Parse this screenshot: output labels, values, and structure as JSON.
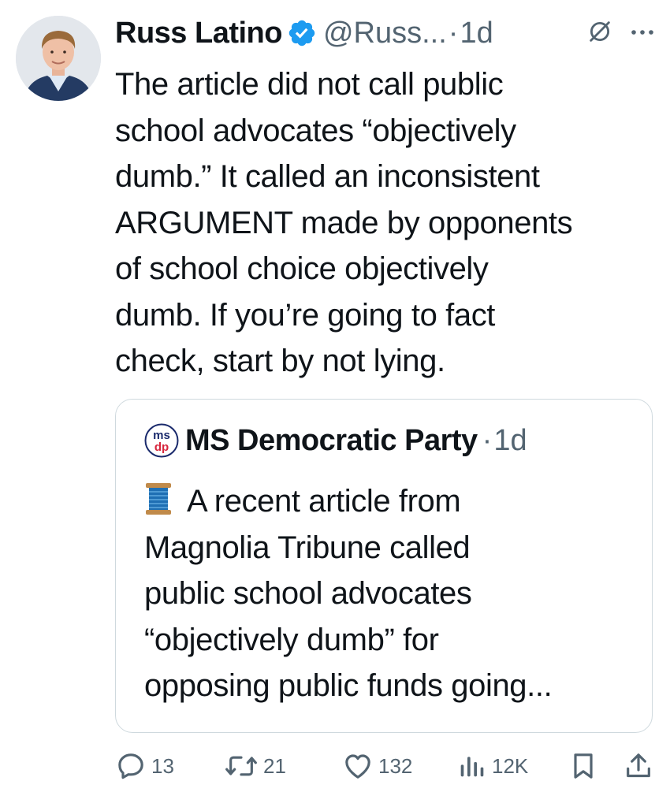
{
  "tweet": {
    "author_name": "Russ Latino",
    "handle": "@Russ...",
    "separator": "·",
    "time": "1d",
    "body_lines": [
      "The article did not call public",
      "school advocates “objectively",
      "dumb.” It called an inconsistent",
      "ARGUMENT made by opponents",
      "of school choice objectively",
      "dumb. If you’re going to fact",
      "check, start by not lying."
    ]
  },
  "quoted_tweet": {
    "author_name": "MS Democratic Party",
    "separator": "·",
    "time": "1d",
    "logo_text_top": "ms",
    "logo_text_bottom": "dp",
    "body_lines": [
      "A recent article from",
      "Magnolia Tribune called",
      "public school advocates",
      "“objectively dumb” for",
      "opposing public funds going..."
    ]
  },
  "actions": {
    "replies": "13",
    "retweets": "21",
    "likes": "132",
    "views": "12K"
  },
  "colors": {
    "text": "#0f1419",
    "secondary": "#536471",
    "verified": "#1d9bf0",
    "border": "#cfd9de"
  },
  "icons": [
    "verified-badge-icon",
    "grok-icon",
    "more-icon",
    "spool-emoji-icon",
    "reply-icon",
    "retweet-icon",
    "like-icon",
    "views-icon",
    "bookmark-icon",
    "share-icon"
  ]
}
